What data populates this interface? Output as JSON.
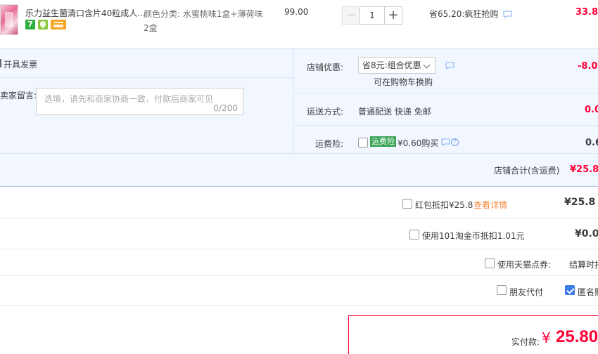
{
  "product": {
    "title": "乐力益生菌清口含片40粒成人...",
    "sku_label": "颜色分类:",
    "sku_value": "水蜜桃味1盒+薄荷味2盒",
    "unit_price": "99.00",
    "quantity": "1",
    "minus": "−",
    "plus": "+",
    "promo": "省65.20:疯狂抢购",
    "line_total": "33.8",
    "badge_7": "7"
  },
  "shop": {
    "invoice": "开具发票",
    "message_label": "卖家留言:",
    "message_placeholder": "选填，请先和商家协商一致，付款后商家可见",
    "message_count": "0/200",
    "coupon_label": "店铺优惠:",
    "coupon_selected": "省8元:组合优惠",
    "coupon_hint": "可在购物车换购",
    "coupon_value": "-8.0",
    "shipping_label": "运送方式:",
    "shipping_value": "普通配送 快递 免邮",
    "shipping_cost": "0.0",
    "insurance_label": "运费险:",
    "insurance_tag": "运费险",
    "insurance_text": "¥0.60购买",
    "insurance_value": "0.6",
    "help_q": "?",
    "total_label": "店铺合计(含运费)",
    "total_value": "¥25.8"
  },
  "payment": {
    "redpacket_text": "红包抵扣¥25.8",
    "redpacket_link": "查看详情",
    "redpacket_amount": "¥25.8",
    "taojinbi_text": "使用101淘金币抵扣1.01元",
    "taojinbi_amount": "¥0.0",
    "tmall_points_text": "使用天猫点券:",
    "tmall_points_right": "结算时扣",
    "friend_pay": "朋友代付",
    "anonymous": "匿名购",
    "final_label": "实付款:",
    "final_yen": "¥",
    "final_value": "25.80"
  },
  "colors": {
    "accent_red": "#ff0036",
    "panel_bg": "#f2f7ff",
    "link_orange": "#f7843b",
    "checkbox_blue": "#3d7be8",
    "insurance_green": "#3aa556"
  }
}
